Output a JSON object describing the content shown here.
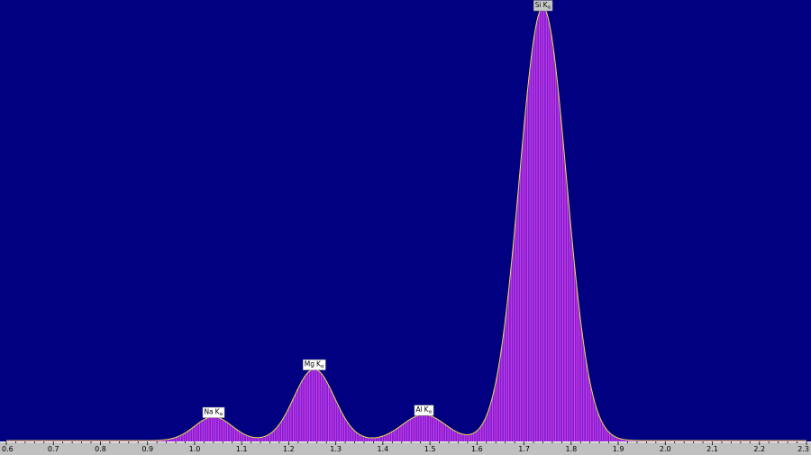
{
  "chart_data": {
    "type": "area",
    "title": "",
    "xlabel": "",
    "ylabel": "",
    "xlim": [
      0.6,
      2.3
    ],
    "ylim": [
      0,
      1
    ],
    "grid": false,
    "background": "#000080",
    "fill_color": "#7a1fd6",
    "hatch_color": "#e040e0",
    "outline_color": "#e6e04a",
    "axis_color": "#c0c0c0",
    "x_ticks": [
      0.6,
      0.7,
      0.8,
      0.9,
      1.0,
      1.1,
      1.2,
      1.3,
      1.4,
      1.5,
      1.6,
      1.7,
      1.8,
      1.9,
      2.0,
      2.1,
      2.2,
      2.3
    ],
    "x_tick_labels": [
      "0.6",
      "0.7",
      "0.8",
      "0.9",
      "1.0",
      "1.1",
      "1.2",
      "1.3",
      "1.4",
      "1.5",
      "1.6",
      "1.7",
      "1.8",
      "1.9",
      "2.0",
      "2.1",
      "2.2",
      "2.3"
    ],
    "peaks": [
      {
        "element": "Na",
        "line": "K",
        "sub": "α",
        "energy": 1.04,
        "height": 0.055,
        "sigma": 0.04
      },
      {
        "element": "Mg",
        "line": "K",
        "sub": "α",
        "energy": 1.254,
        "height": 0.165,
        "sigma": 0.043
      },
      {
        "element": "Al",
        "line": "K",
        "sub": "α",
        "energy": 1.487,
        "height": 0.06,
        "sigma": 0.046
      },
      {
        "element": "Si",
        "line": "K",
        "sub": "α",
        "energy": 1.74,
        "height": 1.0,
        "sigma": 0.05
      }
    ]
  }
}
